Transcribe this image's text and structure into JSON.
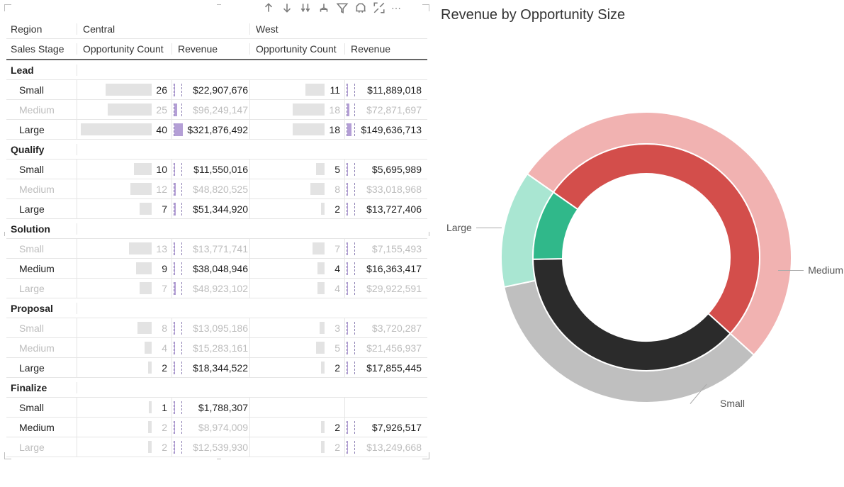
{
  "toolbar": {
    "icons": [
      "arrow-up",
      "arrow-down",
      "drill-down",
      "hierarchy",
      "filter",
      "spotlight",
      "focus",
      "more"
    ]
  },
  "matrix": {
    "row_header1": "Region",
    "row_header2": "Sales Stage",
    "regions": [
      "Central",
      "West"
    ],
    "measure_labels": [
      "Opportunity Count",
      "Revenue"
    ],
    "count_max": 40,
    "rev_max": 321876492,
    "groups": [
      {
        "name": "Lead",
        "rows": [
          {
            "label": "Small",
            "dim": false,
            "c": [
              26,
              11
            ],
            "r": [
              "$22,907,676",
              "$11,889,018"
            ],
            "rv": [
              22907676,
              11889018
            ]
          },
          {
            "label": "Medium",
            "dim": true,
            "c": [
              25,
              18
            ],
            "r": [
              "$96,249,147",
              "$72,871,697"
            ],
            "rv": [
              96249147,
              72871697
            ]
          },
          {
            "label": "Large",
            "dim": false,
            "c": [
              40,
              18
            ],
            "r": [
              "$321,876,492",
              "$149,636,713"
            ],
            "rv": [
              321876492,
              149636713
            ]
          }
        ]
      },
      {
        "name": "Qualify",
        "rows": [
          {
            "label": "Small",
            "dim": false,
            "c": [
              10,
              5
            ],
            "r": [
              "$11,550,016",
              "$5,695,989"
            ],
            "rv": [
              11550016,
              5695989
            ]
          },
          {
            "label": "Medium",
            "dim": true,
            "c": [
              12,
              8
            ],
            "r": [
              "$48,820,525",
              "$33,018,968"
            ],
            "rv": [
              48820525,
              33018968
            ]
          },
          {
            "label": "Large",
            "dim": false,
            "c": [
              7,
              2
            ],
            "r": [
              "$51,344,920",
              "$13,727,406"
            ],
            "rv": [
              51344920,
              13727406
            ]
          }
        ]
      },
      {
        "name": "Solution",
        "rows": [
          {
            "label": "Small",
            "dim": true,
            "c": [
              13,
              7
            ],
            "r": [
              "$13,771,741",
              "$7,155,493"
            ],
            "rv": [
              13771741,
              7155493
            ]
          },
          {
            "label": "Medium",
            "dim": false,
            "c": [
              9,
              4
            ],
            "r": [
              "$38,048,946",
              "$16,363,417"
            ],
            "rv": [
              38048946,
              16363417
            ]
          },
          {
            "label": "Large",
            "dim": true,
            "c": [
              7,
              4
            ],
            "r": [
              "$48,923,102",
              "$29,922,591"
            ],
            "rv": [
              48923102,
              29922591
            ]
          }
        ]
      },
      {
        "name": "Proposal",
        "rows": [
          {
            "label": "Small",
            "dim": true,
            "c": [
              8,
              3
            ],
            "r": [
              "$13,095,186",
              "$3,720,287"
            ],
            "rv": [
              13095186,
              3720287
            ]
          },
          {
            "label": "Medium",
            "dim": true,
            "c": [
              4,
              5
            ],
            "r": [
              "$15,283,161",
              "$21,456,937"
            ],
            "rv": [
              15283161,
              21456937
            ]
          },
          {
            "label": "Large",
            "dim": false,
            "c": [
              2,
              2
            ],
            "r": [
              "$18,344,522",
              "$17,855,445"
            ],
            "rv": [
              18344522,
              17855445
            ]
          }
        ]
      },
      {
        "name": "Finalize",
        "rows": [
          {
            "label": "Small",
            "dim": false,
            "c": [
              1,
              null
            ],
            "r": [
              "$1,788,307",
              null
            ],
            "rv": [
              1788307,
              null
            ]
          },
          {
            "label": "Medium",
            "dim": false,
            "c": [
              2,
              2
            ],
            "cdim": [
              true,
              false
            ],
            "r": [
              "$8,974,009",
              "$7,926,517"
            ],
            "rdim": [
              true,
              false
            ],
            "rv": [
              8974009,
              7926517
            ]
          },
          {
            "label": "Large",
            "dim": true,
            "c": [
              2,
              2
            ],
            "r": [
              "$12,539,930",
              "$13,249,668"
            ],
            "rv": [
              12539930,
              13249668
            ]
          }
        ]
      }
    ]
  },
  "donut": {
    "title": "Revenue by Opportunity Size",
    "labels": {
      "large": "Large",
      "medium": "Medium",
      "small": "Small"
    }
  },
  "chart_data": {
    "type": "pie",
    "title": "Revenue by Opportunity Size",
    "series": [
      {
        "name": "inner",
        "slices": [
          {
            "label": "Large",
            "value": 52,
            "color": "#d34e4b"
          },
          {
            "label": "Medium",
            "value": 38,
            "color": "#2b2b2b"
          },
          {
            "label": "Small",
            "value": 10,
            "color": "#30b88a"
          }
        ]
      },
      {
        "name": "outer",
        "slices": [
          {
            "label": "Large",
            "value": 52,
            "color": "#f1b2b1"
          },
          {
            "label": "Medium",
            "value": 35,
            "color": "#bfbfbf"
          },
          {
            "label": "Small",
            "value": 13,
            "color": "#a9e6d2"
          }
        ]
      }
    ]
  }
}
